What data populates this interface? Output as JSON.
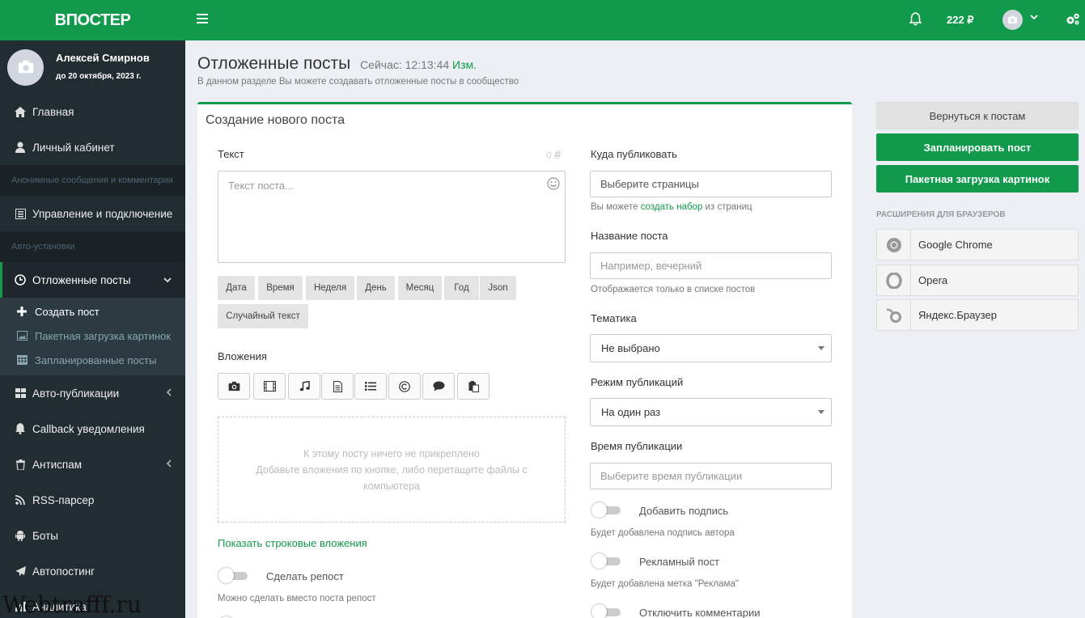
{
  "app": {
    "logo": "ВПОСТЕР"
  },
  "user": {
    "name": "Алексей Смирнов",
    "date": "до 20 октября, 2023 г."
  },
  "header": {
    "balance": "222 ₽"
  },
  "sidebar": {
    "items": [
      {
        "label": "Главная",
        "icon": "home-icon"
      },
      {
        "label": "Личный кабинет",
        "icon": "user-icon"
      }
    ],
    "header1": "Анонимные сообщения и комментарии",
    "item3": "Управление и подключение",
    "header2": "Авто-установки",
    "active": "Отложенные посты",
    "sub": [
      {
        "label": "Создать пост"
      },
      {
        "label": "Пакетная загрузка картинок"
      },
      {
        "label": "Запланированные посты"
      }
    ],
    "rest": [
      {
        "label": "Авто-публикации"
      },
      {
        "label": "Callback уведомления"
      },
      {
        "label": "Антиспам"
      },
      {
        "label": "RSS-парсер"
      },
      {
        "label": "Боты"
      },
      {
        "label": "Автопостинг"
      },
      {
        "label": "Аналитика"
      }
    ]
  },
  "page": {
    "title": "Отложенные посты",
    "time_prefix": "Сейчас: 12:13:44",
    "time_link": "Изм.",
    "desc": "В данном разделе Вы можете создавать отложенные посты в сообщество"
  },
  "form": {
    "box_title": "Создание нового поста",
    "text_label": "Текст",
    "counter": "0",
    "text_placeholder": "Текст поста...",
    "tags": [
      "Дата",
      "Время",
      "Неделя",
      "День",
      "Месяц",
      "Год",
      "Json",
      "Случайный текст"
    ],
    "attachments_label": "Вложения",
    "drop_line1": "К этому посту ничего не прикреплено",
    "drop_line2": "Добавьте вложения по кнопке, либо перетащите файлы с компьютера",
    "show_string_link": "Показать строковые вложения",
    "repost_label": "Сделать репост",
    "repost_hint": "Можно сделать вместо поста репост",
    "where_label": "Куда публиковать",
    "where_placeholder": "Выберите страницы",
    "where_hint_pre": "Вы можете ",
    "where_hint_link": "создать набор",
    "where_hint_post": " из страниц",
    "name_label": "Название поста",
    "name_placeholder": "Например, вечерний",
    "name_hint": "Отображается только в списке постов",
    "topic_label": "Тематика",
    "topic_value": "Не выбрано",
    "mode_label": "Режим публикаций",
    "mode_value": "На один раз",
    "time_label": "Время публикации",
    "time_placeholder": "Выберите время публикации",
    "sign_label": "Добавить подпись",
    "sign_hint": "Будет добавлена подпись автора",
    "ad_label": "Рекламный пост",
    "ad_hint": "Будет добавлена метка \"Реклама\"",
    "comments_label": "Отключить комментарии"
  },
  "right": {
    "back": "Вернуться к постам",
    "schedule": "Запланировать пост",
    "batch": "Пакетная загрузка картинок",
    "ext_title": "РАСШИРЕНИЯ ДЛЯ БРАУЗЕРОВ",
    "exts": [
      "Google Chrome",
      "Opera",
      "Яндекс.Браузер"
    ]
  },
  "watermark": "Webtrafff.ru",
  "colors": {
    "accent": "#119a4b",
    "sidebar": "#222d32"
  }
}
